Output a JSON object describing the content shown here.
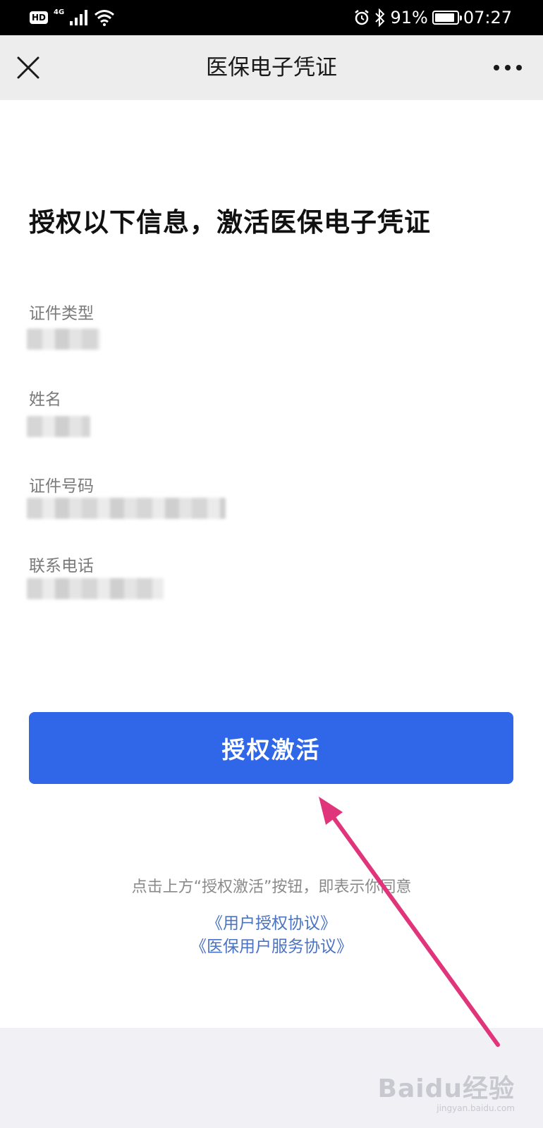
{
  "status_bar": {
    "hd": "HD",
    "network": "4G",
    "battery_percent": "91%",
    "battery_level": 0.91,
    "time": "07:27",
    "icons": [
      "signal-icon",
      "wifi-icon",
      "alarm-icon",
      "bluetooth-icon",
      "battery-icon"
    ]
  },
  "nav": {
    "title": "医保电子凭证",
    "close_icon": "close-icon",
    "more_icon": "more-icon"
  },
  "heading": "授权以下信息，激活医保电子凭证",
  "fields": [
    {
      "label": "证件类型",
      "value_masked": true
    },
    {
      "label": "姓名",
      "value_masked": true
    },
    {
      "label": "证件号码",
      "value_masked": true
    },
    {
      "label": "联系电话",
      "value_masked": true
    }
  ],
  "primary_button": {
    "label": "授权激活"
  },
  "agreement": {
    "text": "点击上方“授权激活”按钮，即表示你同意",
    "links": [
      "《用户授权协议》",
      "《医保用户服务协议》"
    ]
  },
  "annotation_color": "#e0357a",
  "button_color": "#2f67e8",
  "watermark": {
    "main": "Baidu经验",
    "sub": "jingyan.baidu.com"
  }
}
